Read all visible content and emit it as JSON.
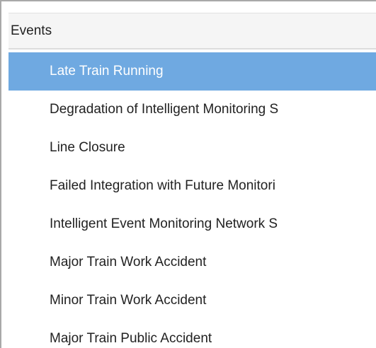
{
  "panel": {
    "header": "Events",
    "selected_index": 0,
    "items": [
      {
        "label": "Late Train Running"
      },
      {
        "label": "Degradation of Intelligent Monitoring S"
      },
      {
        "label": "Line Closure"
      },
      {
        "label": "Failed Integration with Future Monitori"
      },
      {
        "label": "Intelligent Event Monitoring Network S"
      },
      {
        "label": "Major Train Work Accident"
      },
      {
        "label": "Minor Train Work Accident"
      },
      {
        "label": "Major Train Public Accident"
      }
    ]
  },
  "colors": {
    "selected_bg": "#6fa9e1",
    "header_bg": "#f5f5f5",
    "text": "#222222"
  }
}
